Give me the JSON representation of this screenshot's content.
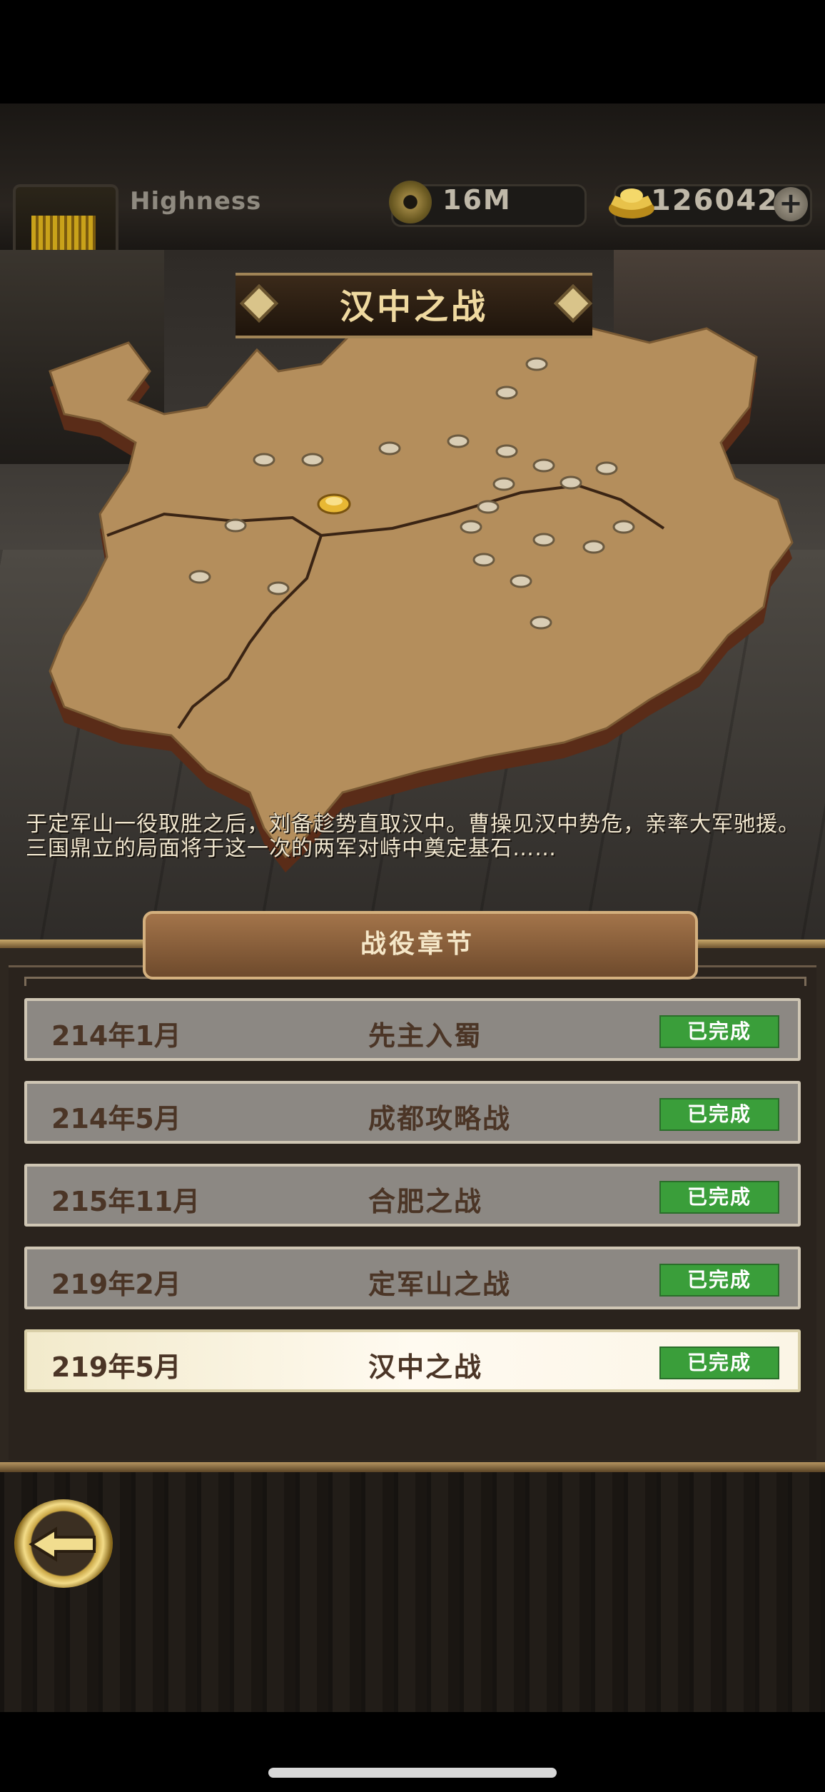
{
  "header": {
    "player_name": "Highness",
    "coins": "16M",
    "ingots": "126042",
    "add_button_label": "+"
  },
  "battle": {
    "title": "汉中之战",
    "description": "于定军山一役取胜之后，刘备趁势直取汉中。曹操见汉中势危，亲率大军驰援。三国鼎立的局面将于这一次的两军对峙中奠定基石……"
  },
  "chapters": {
    "header": "战役章节",
    "items": [
      {
        "date": "214年1月",
        "name": "先主入蜀",
        "status": "已完成",
        "active": false
      },
      {
        "date": "214年5月",
        "name": "成都攻略战",
        "status": "已完成",
        "active": false
      },
      {
        "date": "215年11月",
        "name": "合肥之战",
        "status": "已完成",
        "active": false
      },
      {
        "date": "219年2月",
        "name": "定军山之战",
        "status": "已完成",
        "active": false
      },
      {
        "date": "219年5月",
        "name": "汉中之战",
        "status": "已完成",
        "active": true
      }
    ]
  },
  "icons": {
    "coin": "coin-icon",
    "ingot": "gold-ingot-icon",
    "back": "back-arrow-icon",
    "city": "city-marker-icon",
    "current_city": "current-city-marker-icon"
  },
  "colors": {
    "status_complete": "#3a9e3a",
    "map_land": "#b48e5c",
    "panel_bg": "#2e2720"
  }
}
